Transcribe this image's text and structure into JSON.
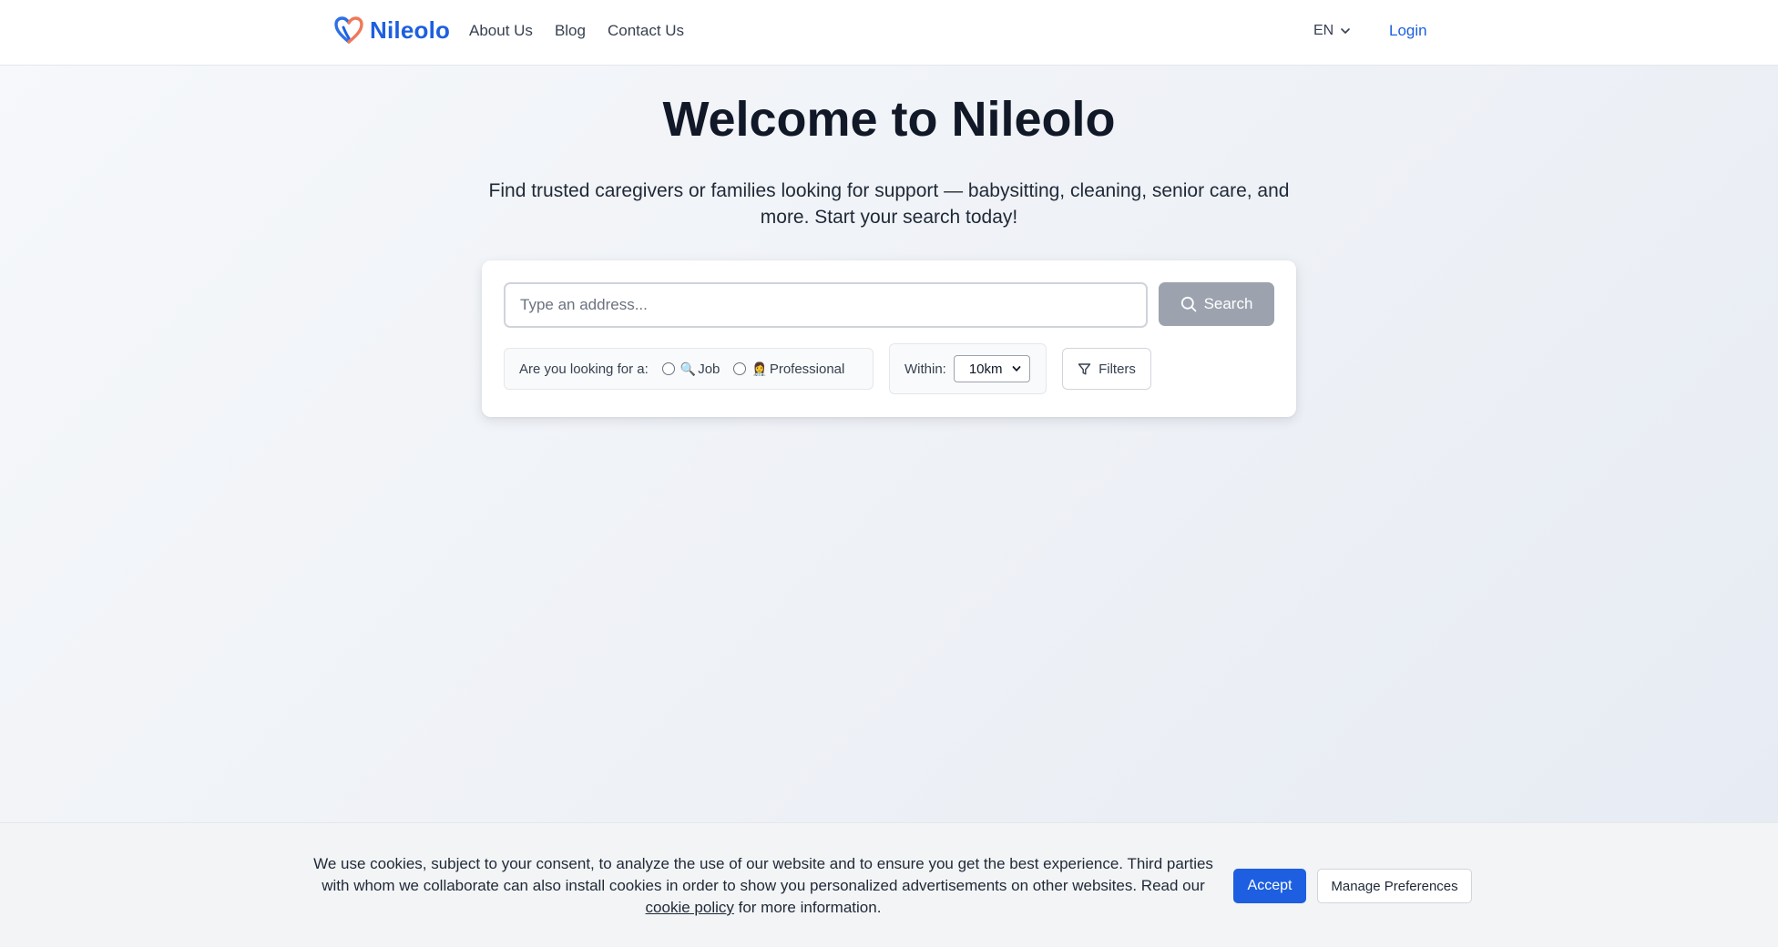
{
  "header": {
    "logo_text": "Nileolo",
    "nav": [
      "About Us",
      "Blog",
      "Contact Us"
    ],
    "language": "EN",
    "login_label": "Login",
    "brand_color": "#1d5fe0",
    "logo_accent": "#f0785a"
  },
  "hero": {
    "title": "Welcome to Nileolo",
    "subtitle": "Find trusted caregivers or families looking for support — babysitting, cleaning, senior care, and more. Start your search today!"
  },
  "search": {
    "address_placeholder": "Type an address...",
    "address_value": "",
    "search_label": "Search",
    "looking_for_label": "Are you looking for a:",
    "options": [
      {
        "icon": "🔍",
        "label": "Job"
      },
      {
        "icon": "👩‍⚕️",
        "label": "Professional"
      }
    ],
    "within_label": "Within:",
    "within_value": "10km",
    "filters_label": "Filters"
  },
  "cookie": {
    "text_before": "We use cookies, subject to your consent, to analyze the use of our website and to ensure you get the best experience. Third parties with whom we collaborate can also install cookies in order to show you personalized advertisements on other websites. Read our ",
    "link_text": "cookie policy",
    "text_after": " for more information.",
    "accept_label": "Accept",
    "manage_label": "Manage Preferences"
  }
}
